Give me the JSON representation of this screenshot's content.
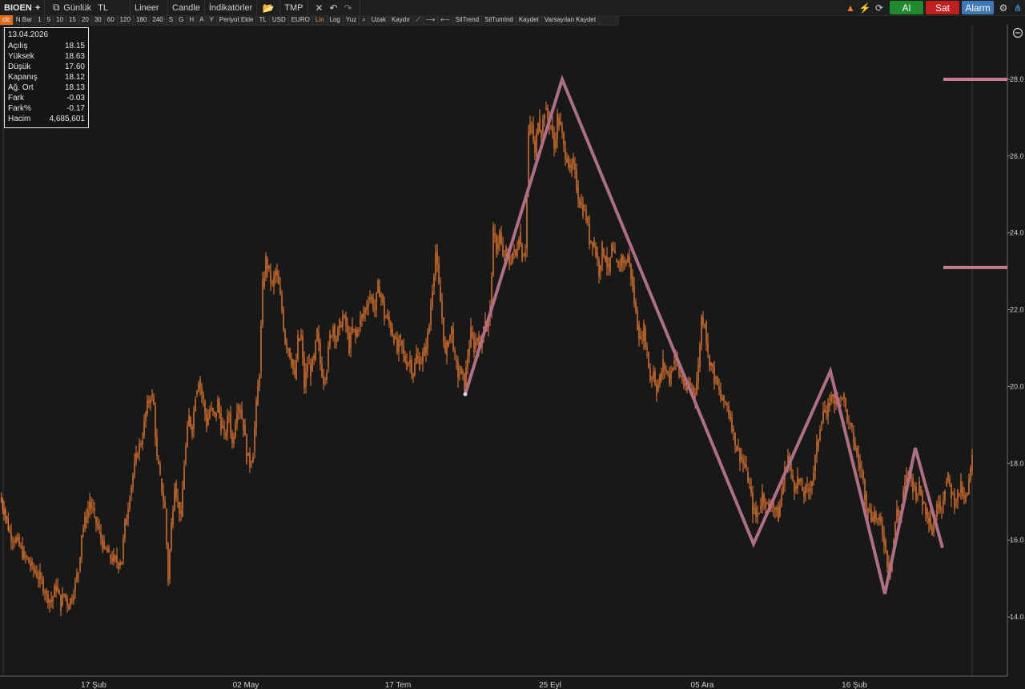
{
  "toolbar": {
    "symbol": "BIOEN",
    "add": "+",
    "period": "Günlük",
    "currency": "TL",
    "scale": "Lineer",
    "chart_type": "Candle",
    "indicators": "İndikatörler",
    "tmp": "TMP",
    "buy": "Al",
    "sell": "Sat",
    "alarm": "Alarm"
  },
  "toolbar2": [
    "N Bar",
    "1",
    "5",
    "10",
    "15",
    "20",
    "30",
    "60",
    "120",
    "180",
    "240",
    "S",
    "G",
    "H",
    "A",
    "Y",
    "Periyot Ekle",
    "TL",
    "USD",
    "EURO",
    "Lin",
    "Log",
    "Yuz",
    "Uzak",
    "Kaydır",
    "SilTrend",
    "SilTumInd",
    "Kaydet",
    "Varsayılan Kaydet"
  ],
  "toolbar2_first": "clc",
  "info": {
    "date": "13.04.2026",
    "rows": [
      {
        "label": "Açılış",
        "value": "18.15"
      },
      {
        "label": "Yüksek",
        "value": "18.63"
      },
      {
        "label": "Düşük",
        "value": "17.60"
      },
      {
        "label": "Kapanış",
        "value": "18.12"
      },
      {
        "label": "Ağ. Ort",
        "value": "18.13"
      },
      {
        "label": "Fark",
        "value": "-0.03"
      },
      {
        "label": "Fark%",
        "value": "-0.17"
      },
      {
        "label": "Hacim",
        "value": "4,685,601"
      }
    ]
  },
  "colors": {
    "candle": "#f07a2e",
    "zigzag": "#b06e86",
    "level": "#c97a8e",
    "bg": "#161918"
  },
  "chart_data": {
    "type": "line",
    "ylim": [
      13,
      29
    ],
    "y_ticks": [
      "14.0",
      "16.0",
      "18.0",
      "20.0",
      "22.0",
      "24.0",
      "26.0",
      "28.0"
    ],
    "x_ticks": [
      "17 Şub",
      "02 May",
      "17 Tem",
      "25 Eyl",
      "05 Ara",
      "16 Şub"
    ],
    "price_path": [
      [
        0,
        17.1
      ],
      [
        5,
        16.8
      ],
      [
        12,
        16.2
      ],
      [
        20,
        16.0
      ],
      [
        30,
        15.6
      ],
      [
        40,
        15.3
      ],
      [
        50,
        15.0
      ],
      [
        58,
        14.6
      ],
      [
        64,
        14.4
      ],
      [
        70,
        14.8
      ],
      [
        76,
        14.3
      ],
      [
        80,
        14.6
      ],
      [
        86,
        14.3
      ],
      [
        92,
        14.7
      ],
      [
        98,
        15.2
      ],
      [
        102,
        16.2
      ],
      [
        108,
        16.6
      ],
      [
        112,
        17.0
      ],
      [
        118,
        16.6
      ],
      [
        124,
        16.2
      ],
      [
        130,
        15.8
      ],
      [
        136,
        15.6
      ],
      [
        142,
        15.5
      ],
      [
        148,
        15.4
      ],
      [
        152,
        15.5
      ],
      [
        156,
        16.4
      ],
      [
        162,
        17.2
      ],
      [
        166,
        17.7
      ],
      [
        172,
        18.3
      ],
      [
        178,
        18.7
      ],
      [
        182,
        19.3
      ],
      [
        188,
        19.8
      ],
      [
        192,
        19.5
      ],
      [
        196,
        18.1
      ],
      [
        200,
        17.6
      ],
      [
        206,
        16.8
      ],
      [
        210,
        15.0
      ],
      [
        214,
        16.4
      ],
      [
        218,
        17.5
      ],
      [
        222,
        17.0
      ],
      [
        226,
        16.6
      ],
      [
        230,
        18.0
      ],
      [
        236,
        19.2
      ],
      [
        240,
        18.9
      ],
      [
        244,
        19.8
      ],
      [
        248,
        20.2
      ],
      [
        254,
        19.6
      ],
      [
        258,
        19.0
      ],
      [
        262,
        19.4
      ],
      [
        268,
        19.2
      ],
      [
        272,
        19.6
      ],
      [
        276,
        19.0
      ],
      [
        280,
        18.7
      ],
      [
        286,
        19.3
      ],
      [
        290,
        18.5
      ],
      [
        296,
        19.5
      ],
      [
        300,
        19.4
      ],
      [
        304,
        19.0
      ],
      [
        308,
        18.2
      ],
      [
        312,
        18.0
      ],
      [
        316,
        18.3
      ],
      [
        320,
        19.5
      ],
      [
        324,
        20.4
      ],
      [
        328,
        22.6
      ],
      [
        332,
        23.3
      ],
      [
        336,
        23.0
      ],
      [
        340,
        22.6
      ],
      [
        344,
        23.0
      ],
      [
        348,
        22.6
      ],
      [
        352,
        22.0
      ],
      [
        356,
        21.2
      ],
      [
        360,
        21.0
      ],
      [
        364,
        20.7
      ],
      [
        368,
        20.2
      ],
      [
        372,
        21.2
      ],
      [
        376,
        21.3
      ],
      [
        380,
        20.0
      ],
      [
        384,
        20.6
      ],
      [
        388,
        20.4
      ],
      [
        392,
        20.7
      ],
      [
        396,
        21.4
      ],
      [
        400,
        20.6
      ],
      [
        404,
        20.2
      ],
      [
        408,
        20.5
      ],
      [
        412,
        21.3
      ],
      [
        416,
        21.6
      ],
      [
        420,
        21.2
      ],
      [
        424,
        21.6
      ],
      [
        428,
        21.8
      ],
      [
        432,
        21.6
      ],
      [
        436,
        21.0
      ],
      [
        440,
        21.5
      ],
      [
        444,
        21.3
      ],
      [
        448,
        21.6
      ],
      [
        452,
        21.8
      ],
      [
        456,
        22.0
      ],
      [
        460,
        22.3
      ],
      [
        464,
        22.3
      ],
      [
        468,
        22.0
      ],
      [
        472,
        22.6
      ],
      [
        476,
        22.4
      ],
      [
        480,
        21.8
      ],
      [
        484,
        21.8
      ],
      [
        488,
        21.5
      ],
      [
        492,
        21.3
      ],
      [
        496,
        20.9
      ],
      [
        500,
        21.2
      ],
      [
        504,
        20.8
      ],
      [
        508,
        20.6
      ],
      [
        512,
        20.7
      ],
      [
        516,
        20.3
      ],
      [
        520,
        20.8
      ],
      [
        524,
        20.6
      ],
      [
        528,
        20.8
      ],
      [
        532,
        21.0
      ],
      [
        536,
        21.6
      ],
      [
        540,
        22.6
      ],
      [
        544,
        23.5
      ],
      [
        548,
        22.6
      ],
      [
        552,
        21.8
      ],
      [
        556,
        20.8
      ],
      [
        560,
        21.2
      ],
      [
        564,
        21.5
      ],
      [
        568,
        20.7
      ],
      [
        572,
        20.3
      ],
      [
        576,
        20.4
      ],
      [
        580,
        20.0
      ],
      [
        584,
        20.8
      ],
      [
        588,
        21.4
      ],
      [
        592,
        21.0
      ],
      [
        596,
        21.3
      ],
      [
        600,
        21.0
      ],
      [
        604,
        21.7
      ],
      [
        608,
        21.5
      ],
      [
        612,
        22.0
      ],
      [
        616,
        24.0
      ],
      [
        620,
        23.6
      ],
      [
        624,
        24.0
      ],
      [
        628,
        23.3
      ],
      [
        632,
        23.5
      ],
      [
        636,
        23.2
      ],
      [
        640,
        23.5
      ],
      [
        644,
        23.4
      ],
      [
        648,
        24.0
      ],
      [
        652,
        23.4
      ],
      [
        656,
        23.6
      ],
      [
        660,
        26.6
      ],
      [
        664,
        26.8
      ],
      [
        668,
        26.0
      ],
      [
        672,
        27.0
      ],
      [
        676,
        26.6
      ],
      [
        680,
        27.2
      ],
      [
        684,
        27.0
      ],
      [
        688,
        26.8
      ],
      [
        692,
        26.2
      ],
      [
        696,
        27.0
      ],
      [
        700,
        26.8
      ],
      [
        704,
        26.2
      ],
      [
        708,
        26.0
      ],
      [
        712,
        25.6
      ],
      [
        716,
        25.8
      ],
      [
        720,
        25.2
      ],
      [
        724,
        24.8
      ],
      [
        728,
        24.6
      ],
      [
        732,
        24.4
      ],
      [
        736,
        23.8
      ],
      [
        740,
        23.8
      ],
      [
        744,
        23.5
      ],
      [
        748,
        23.0
      ],
      [
        752,
        23.6
      ],
      [
        756,
        23.4
      ],
      [
        760,
        23.0
      ],
      [
        764,
        23.6
      ],
      [
        768,
        23.3
      ],
      [
        772,
        23.0
      ],
      [
        776,
        23.4
      ],
      [
        780,
        23.2
      ],
      [
        784,
        23.4
      ],
      [
        788,
        22.9
      ],
      [
        792,
        22.2
      ],
      [
        796,
        21.6
      ],
      [
        800,
        21.2
      ],
      [
        804,
        21.5
      ],
      [
        808,
        20.9
      ],
      [
        812,
        20.2
      ],
      [
        816,
        20.4
      ],
      [
        820,
        19.9
      ],
      [
        824,
        20.2
      ],
      [
        828,
        20.6
      ],
      [
        832,
        20.4
      ],
      [
        836,
        20.2
      ],
      [
        840,
        20.6
      ],
      [
        844,
        20.8
      ],
      [
        848,
        20.3
      ],
      [
        852,
        20.2
      ],
      [
        856,
        19.9
      ],
      [
        860,
        20.1
      ],
      [
        864,
        20.0
      ],
      [
        868,
        19.8
      ],
      [
        872,
        20.5
      ],
      [
        876,
        21.8
      ],
      [
        880,
        21.7
      ],
      [
        884,
        20.8
      ],
      [
        888,
        20.6
      ],
      [
        892,
        20.2
      ],
      [
        896,
        20.0
      ],
      [
        900,
        19.7
      ],
      [
        904,
        19.6
      ],
      [
        908,
        19.5
      ],
      [
        912,
        19.2
      ],
      [
        916,
        18.8
      ],
      [
        920,
        18.4
      ],
      [
        924,
        18.2
      ],
      [
        928,
        18.0
      ],
      [
        932,
        17.8
      ],
      [
        936,
        17.4
      ],
      [
        940,
        16.8
      ],
      [
        944,
        16.6
      ],
      [
        948,
        16.8
      ],
      [
        952,
        17.2
      ],
      [
        956,
        17.0
      ],
      [
        960,
        16.8
      ],
      [
        964,
        17.0
      ],
      [
        968,
        16.8
      ],
      [
        972,
        16.6
      ],
      [
        976,
        17.2
      ],
      [
        980,
        17.8
      ],
      [
        984,
        18.2
      ],
      [
        988,
        17.7
      ],
      [
        992,
        17.4
      ],
      [
        996,
        17.6
      ],
      [
        1000,
        17.4
      ],
      [
        1004,
        17.2
      ],
      [
        1008,
        17.3
      ],
      [
        1012,
        17.4
      ],
      [
        1016,
        17.8
      ],
      [
        1020,
        18.4
      ],
      [
        1024,
        19.0
      ],
      [
        1028,
        19.4
      ],
      [
        1032,
        19.2
      ],
      [
        1036,
        19.6
      ],
      [
        1040,
        19.8
      ],
      [
        1044,
        19.5
      ],
      [
        1048,
        19.7
      ],
      [
        1052,
        19.8
      ],
      [
        1056,
        19.4
      ],
      [
        1060,
        19.0
      ],
      [
        1064,
        18.8
      ],
      [
        1068,
        18.4
      ],
      [
        1072,
        18.0
      ],
      [
        1076,
        17.8
      ],
      [
        1080,
        17.2
      ],
      [
        1084,
        16.8
      ],
      [
        1088,
        16.6
      ],
      [
        1092,
        16.7
      ],
      [
        1096,
        16.5
      ],
      [
        1100,
        16.4
      ],
      [
        1104,
        16.0
      ],
      [
        1108,
        15.4
      ],
      [
        1112,
        15.2
      ],
      [
        1116,
        16.0
      ],
      [
        1120,
        16.8
      ],
      [
        1124,
        16.6
      ],
      [
        1128,
        17.2
      ],
      [
        1132,
        17.6
      ],
      [
        1136,
        17.8
      ],
      [
        1140,
        17.4
      ],
      [
        1144,
        17.2
      ],
      [
        1148,
        17.4
      ],
      [
        1152,
        17.0
      ],
      [
        1156,
        16.8
      ],
      [
        1160,
        16.6
      ],
      [
        1164,
        16.2
      ],
      [
        1168,
        16.6
      ],
      [
        1172,
        17.0
      ],
      [
        1176,
        16.9
      ],
      [
        1180,
        17.4
      ],
      [
        1184,
        17.6
      ],
      [
        1188,
        17.2
      ],
      [
        1192,
        17.0
      ],
      [
        1196,
        17.2
      ],
      [
        1200,
        17.4
      ],
      [
        1204,
        17.0
      ],
      [
        1208,
        17.2
      ],
      [
        1212,
        17.8
      ],
      [
        1214,
        18.1
      ]
    ],
    "zigzag": [
      [
        581,
        19.8
      ],
      [
        702,
        28.0
      ],
      [
        941,
        15.9
      ],
      [
        1037,
        20.4
      ],
      [
        1105,
        14.6
      ],
      [
        1143,
        18.4
      ],
      [
        1177,
        15.8
      ]
    ],
    "levels": [
      28.0,
      23.1
    ]
  }
}
